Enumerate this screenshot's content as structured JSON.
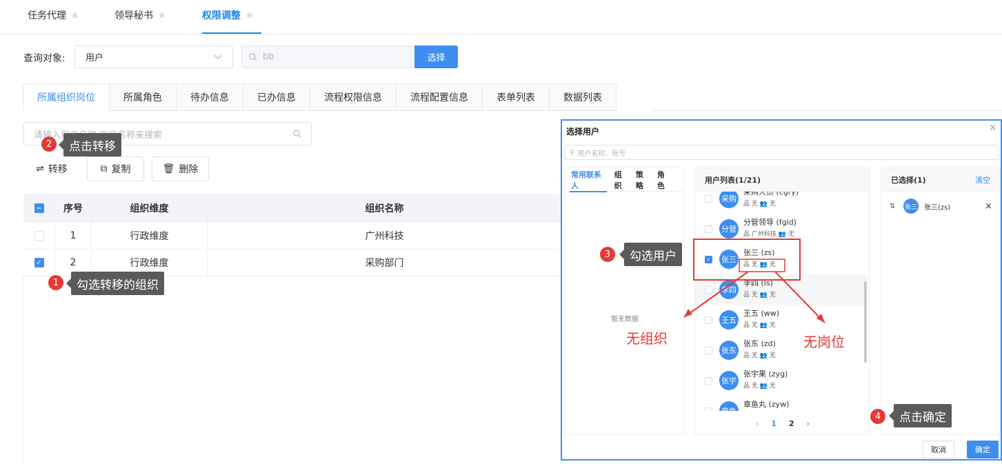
{
  "top_tabs": [
    {
      "label": "任务代理"
    },
    {
      "label": "领导秘书"
    },
    {
      "label": "权限调整"
    }
  ],
  "star": "★",
  "query": {
    "label": "查询对象:",
    "select_value": "用户",
    "search_value": "bb",
    "select_button": "选择"
  },
  "sub_tabs": [
    "所属组织岗位",
    "所属角色",
    "待办信息",
    "已办信息",
    "流程权限信息",
    "流程配置信息",
    "表单列表",
    "数据列表"
  ],
  "filter_placeholder": "请输入用户名称,岗位名称来搜索",
  "actions": {
    "transfer": "转移",
    "copy": "复制",
    "delete": "删除"
  },
  "table": {
    "headers": [
      "序号",
      "组织维度",
      "组织名称"
    ],
    "rows": [
      {
        "no": "1",
        "dimension": "行政维度",
        "name": "广州科技",
        "checked": false
      },
      {
        "no": "2",
        "dimension": "行政维度",
        "name": "采购部门",
        "checked": true
      }
    ]
  },
  "callouts": {
    "c1": {
      "num": "1",
      "text": "勾选转移的组织"
    },
    "c2": {
      "num": "2",
      "text": "点击转移"
    },
    "c3": {
      "num": "3",
      "text": "勾选用户"
    },
    "c4": {
      "num": "4",
      "text": "点击确定"
    }
  },
  "modal": {
    "title": "选择用户",
    "close": "×",
    "search_placeholder": "用户名称、账号",
    "left_tabs": [
      "常用联系人",
      "组织",
      "策略",
      "角色"
    ],
    "empty": "暂无数据",
    "user_list_title": "用户列表(1/21)",
    "users": [
      {
        "avatar": "采购",
        "name": "采购人员 (cgry)",
        "org": "无",
        "post": "无",
        "checked": false
      },
      {
        "avatar": "分管",
        "name": "分管领导 (fgld)",
        "org": "广州科技",
        "post": "无",
        "checked": false
      },
      {
        "avatar": "张三",
        "name": "张三 (zs)",
        "org": "无",
        "post": "无",
        "checked": true
      },
      {
        "avatar": "李四",
        "name": "李四 (ls)",
        "org": "无",
        "post": "无",
        "checked": false
      },
      {
        "avatar": "王五",
        "name": "王五 (ww)",
        "org": "无",
        "post": "无",
        "checked": false
      },
      {
        "avatar": "张东",
        "name": "张东 (zd)",
        "org": "无",
        "post": "无",
        "checked": false
      },
      {
        "avatar": "张宇",
        "name": "张宇果 (zyg)",
        "org": "无",
        "post": "无",
        "checked": false
      },
      {
        "avatar": "章鱼",
        "name": "章鱼丸 (zyw)",
        "org": "",
        "post": "",
        "checked": false
      }
    ],
    "pagination": {
      "prev": "‹",
      "pages": [
        "1",
        "2"
      ],
      "next": "›"
    },
    "selected_title": "已选择(1)",
    "clear": "清空",
    "selected": [
      {
        "avatar": "张三",
        "name": "张三(zs)"
      }
    ],
    "cancel": "取消",
    "confirm": "确定"
  },
  "annotations": {
    "no_org": "无组织",
    "no_post": "无岗位"
  },
  "colors": {
    "primary": "#3d8ef0",
    "annotation_red": "#e53935",
    "callout_bg": "#5a5a5a"
  }
}
